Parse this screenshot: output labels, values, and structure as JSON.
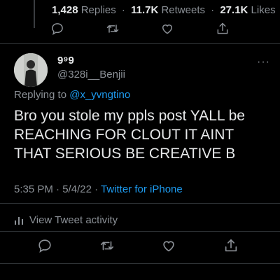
{
  "previous_tweet": {
    "stats": {
      "replies_count": "1,428",
      "replies_label": "Replies",
      "retweets_count": "11.7K",
      "retweets_label": "Retweets",
      "likes_count": "27.1K",
      "likes_label": "Likes",
      "separator": "·"
    },
    "actions": [
      "reply-icon",
      "retweet-icon",
      "like-icon",
      "share-icon"
    ]
  },
  "tweet": {
    "display_name": "9⁹9",
    "handle": "@328i__Benjii",
    "more_label": "···",
    "replying_prefix": "Replying to",
    "replying_to": "@x_yvngtino",
    "text": "Bro you stole my ppls post YALL be REACHING FOR CLOUT IT AINT THAT SERIOUS BE CREATIVE B",
    "time": "5:35 PM",
    "date": "5/4/22",
    "meta_separator": "·",
    "source": "Twitter for iPhone",
    "activity_label": "View Tweet activity",
    "actions": [
      "reply-icon",
      "retweet-icon",
      "like-icon",
      "share-icon"
    ]
  },
  "colors": {
    "background": "#000000",
    "text": "#e7e9ea",
    "secondary": "#8b9096",
    "accent": "#1d9bf0",
    "divider": "#2f3336"
  }
}
